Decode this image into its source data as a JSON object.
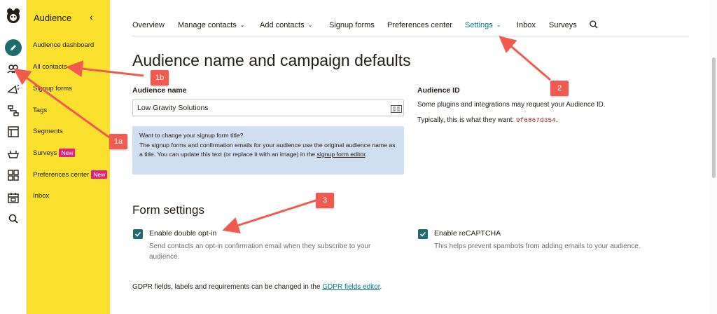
{
  "rail": {
    "icons": [
      "mailchimp-logo-icon",
      "create-pencil-icon",
      "audience-icon",
      "campaigns-megaphone-icon",
      "automations-icon",
      "website-icon",
      "integrations-icon",
      "content-grid-icon",
      "calendar-icon",
      "search-icon"
    ]
  },
  "sidebar": {
    "title": "Audience",
    "collapse_glyph": "‹",
    "items": [
      {
        "label": "Audience dashboard"
      },
      {
        "label": "All contacts"
      },
      {
        "label": "Signup forms"
      },
      {
        "label": "Tags"
      },
      {
        "label": "Segments"
      },
      {
        "label": "Surveys",
        "badge": "New"
      },
      {
        "label": "Preferences center",
        "badge": "New"
      },
      {
        "label": "Inbox"
      }
    ]
  },
  "nav": {
    "items": [
      {
        "label": "Overview"
      },
      {
        "label": "Manage contacts",
        "caret": "⌄"
      },
      {
        "label": "Add contacts",
        "caret": "⌄"
      },
      {
        "label": "Signup forms"
      },
      {
        "label": "Preferences center"
      },
      {
        "label": "Settings",
        "caret": "⌄",
        "active": true
      },
      {
        "label": "Inbox"
      },
      {
        "label": "Surveys"
      }
    ],
    "search_icon": "search-icon"
  },
  "page": {
    "title": "Audience name and campaign defaults"
  },
  "audience_name": {
    "label": "Audience name",
    "value": "Low Gravity Solutions"
  },
  "info_box": {
    "heading": "Want to change your signup form title?",
    "body": "The signup forms and confirmation emails for your audience use the original audience name as a title. You can update this text (or replace it with an image) in the",
    "link": "signup form editor",
    "suffix": "."
  },
  "audience_id": {
    "label": "Audience ID",
    "line1": "Some plugins and integrations may request your Audience ID.",
    "line2": "Typically, this is what they want:",
    "id_value": "9f6867d354",
    "suffix": "."
  },
  "form_settings": {
    "title": "Form settings",
    "double_optin": {
      "label": "Enable double opt-in",
      "help": "Send contacts an opt-in confirmation email when they subscribe to your audience.",
      "checked": true
    },
    "recaptcha": {
      "label": "Enable reCAPTCHA",
      "help": "This helps prevent spambots from adding emails to your audience.",
      "checked": true
    }
  },
  "gdpr": {
    "text": "GDPR fields, labels and requirements can be changed in the",
    "link": "GDPR fields editor",
    "suffix": "."
  },
  "callouts": [
    "1a",
    "1b",
    "2",
    "3"
  ],
  "colors": {
    "sidebar_bg": "#fbe02e",
    "accent_teal": "#007c89",
    "checkbox": "#1f6b6e",
    "info_box": "#cfdef0",
    "badge": "#e0217f",
    "callout": "#f15a4f"
  }
}
